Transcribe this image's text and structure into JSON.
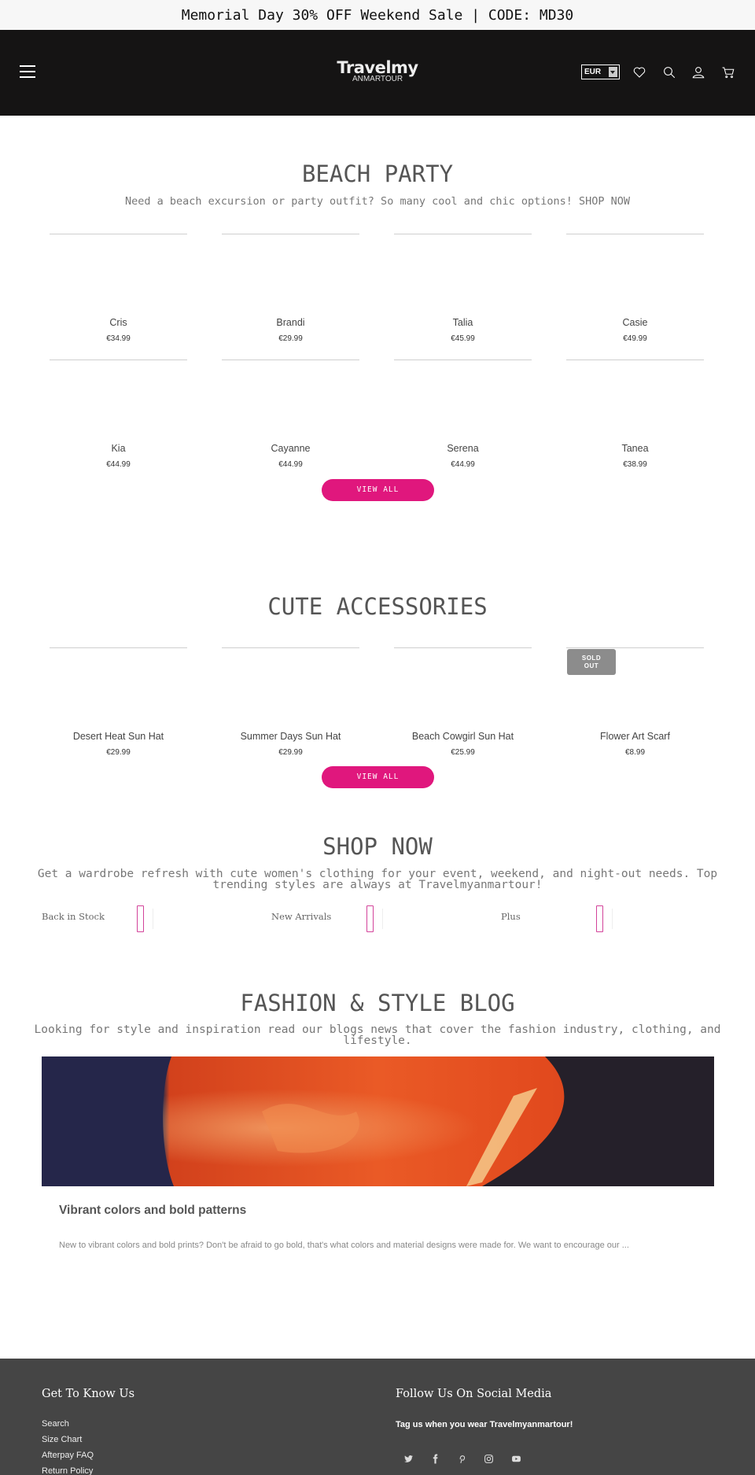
{
  "announcement": "Memorial Day 30% OFF Weekend Sale | CODE: MD30",
  "header": {
    "logo_line1": "Travelmy",
    "logo_line2": "ANMARTOUR",
    "currency": "EUR",
    "icons": [
      "menu-icon",
      "heart-icon",
      "search-icon",
      "user-icon",
      "cart-icon"
    ]
  },
  "beach": {
    "title": "BEACH PARTY",
    "subtitle": "Need a beach excursion or party outfit? So many cool and chic options! SHOP NOW",
    "products": [
      {
        "name": "Cris",
        "price": "€34.99"
      },
      {
        "name": "Brandi",
        "price": "€29.99"
      },
      {
        "name": "Talia",
        "price": "€45.99"
      },
      {
        "name": "Casie",
        "price": "€49.99"
      },
      {
        "name": "Kia",
        "price": "€44.99"
      },
      {
        "name": "Cayanne",
        "price": "€44.99"
      },
      {
        "name": "Serena",
        "price": "€44.99"
      },
      {
        "name": "Tanea",
        "price": "€38.99"
      }
    ],
    "view_all": "VIEW ALL"
  },
  "accessories": {
    "title": "CUTE ACCESSORIES",
    "products": [
      {
        "name": "Desert Heat Sun Hat",
        "price": "€29.99"
      },
      {
        "name": "Summer Days Sun Hat",
        "price": "€29.99"
      },
      {
        "name": "Beach Cowgirl Sun Hat",
        "price": "€25.99"
      },
      {
        "name": "Flower Art Scarf",
        "price": "€8.99"
      }
    ],
    "sold_out_line1": "SOLD",
    "sold_out_line2": "OUT",
    "view_all": "VIEW ALL"
  },
  "shop_now": {
    "title": "SHOP NOW",
    "subtitle_line1": "Get a wardrobe refresh with cute women's clothing for your event, weekend, and night-out needs. Top",
    "subtitle_line2": "trending styles are always at Travelmyanmartour!",
    "links": [
      "Back in Stock",
      "New Arrivals",
      "Plus"
    ]
  },
  "blog": {
    "title": "FASHION & STYLE BLOG",
    "subtitle": "Looking for style and inspiration read our blogs news that cover the fashion industry, clothing, and lifestyle.",
    "post_title": "Vibrant colors and bold patterns",
    "post_excerpt": "New to vibrant colors and bold prints? Don't be afraid to go bold, that's what colors and material designs were made for. We want to encourage our ..."
  },
  "footer": {
    "col1_title": "Get To Know Us",
    "links": [
      "Search",
      "Size Chart",
      "Afterpay FAQ",
      "Return Policy"
    ],
    "col2_title": "Follow Us On Social Media",
    "tagline": "Tag us when you wear Travelmyanmartour!",
    "social_icons": [
      "twitter-icon",
      "facebook-icon",
      "pinterest-icon",
      "instagram-icon",
      "youtube-icon"
    ]
  },
  "colors": {
    "accent": "#e0177d",
    "header_bg": "#151414",
    "footer_bg": "#454545"
  }
}
